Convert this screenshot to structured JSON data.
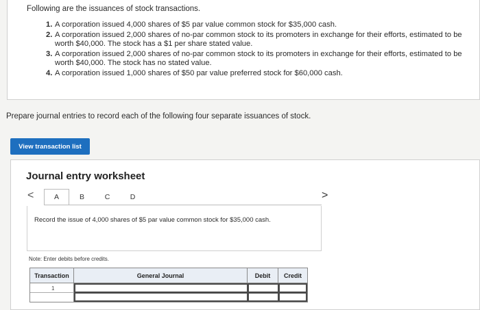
{
  "problem": {
    "intro": "Following are the issuances of stock transactions.",
    "items": [
      {
        "num": "1.",
        "text": "A corporation issued 4,000 shares of $5 par value common stock for $35,000 cash."
      },
      {
        "num": "2.",
        "text": "A corporation issued 2,000 shares of no-par common stock to its promoters in exchange for their efforts, estimated to be worth $40,000. The stock has a $1 per share stated value."
      },
      {
        "num": "3.",
        "text": "A corporation issued 2,000 shares of no-par common stock to its promoters in exchange for their efforts, estimated to be worth $40,000. The stock has no stated value."
      },
      {
        "num": "4.",
        "text": "A corporation issued 1,000 shares of $50 par value preferred stock for $60,000 cash."
      }
    ]
  },
  "prompt": "Prepare journal entries to record each of the following four separate issuances of stock.",
  "view_button": "View transaction list",
  "worksheet": {
    "title": "Journal entry worksheet",
    "nav_prev": "<",
    "nav_next": ">",
    "tabs": [
      "A",
      "B",
      "C",
      "D"
    ],
    "description": "Record the issue of 4,000 shares of $5 par value common stock for $35,000 cash.",
    "note": "Note: Enter debits before credits.",
    "columns": {
      "transaction": "Transaction",
      "general_journal": "General Journal",
      "debit": "Debit",
      "credit": "Credit"
    },
    "rows": [
      {
        "transaction": "1"
      }
    ]
  }
}
